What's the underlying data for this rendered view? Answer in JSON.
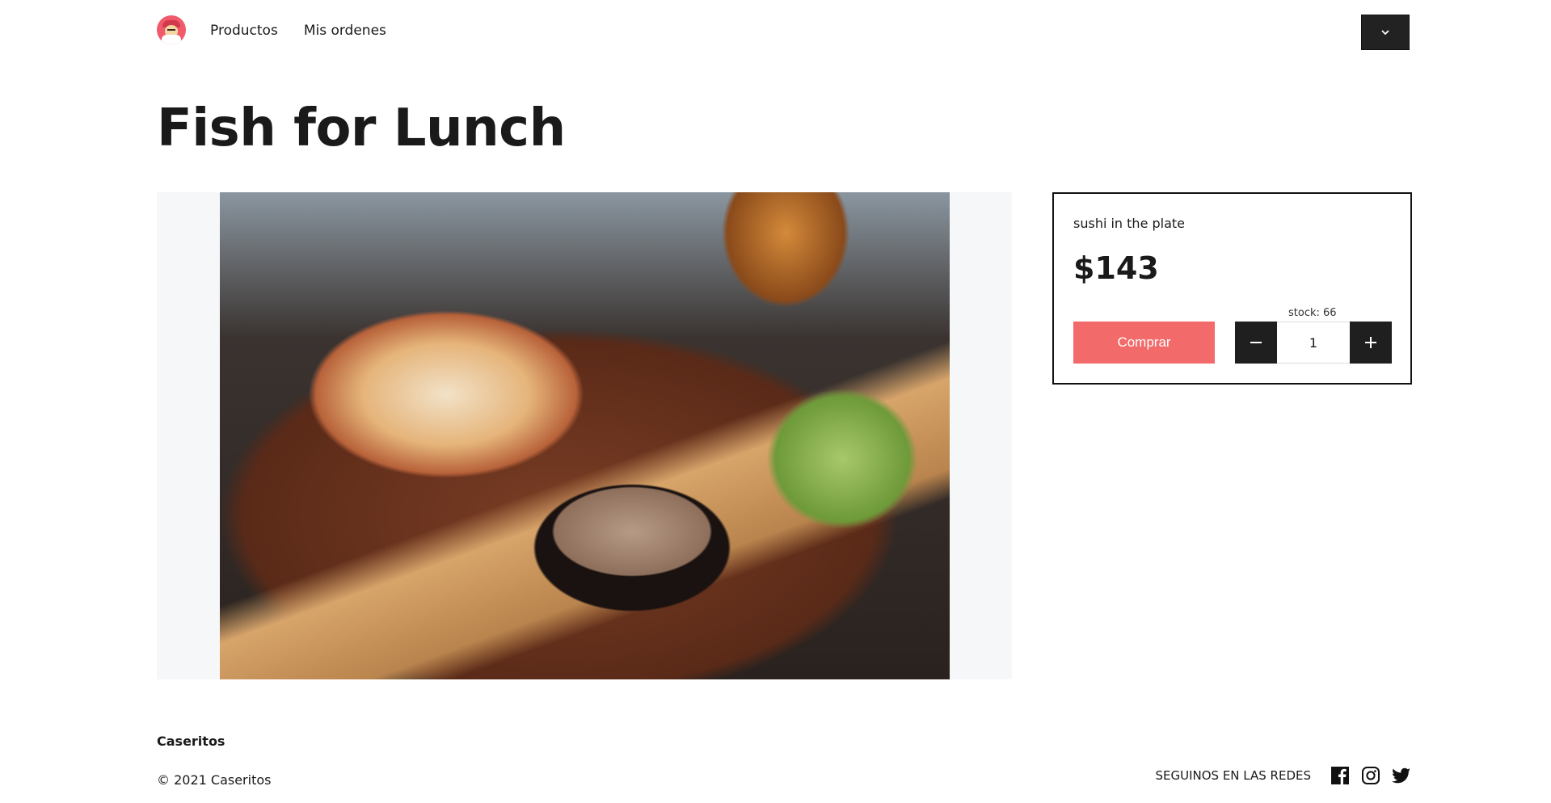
{
  "header": {
    "logo": "caseritos-logo",
    "nav": [
      {
        "label": "Productos"
      },
      {
        "label": "Mis ordenes"
      }
    ],
    "menu_icon": "chevron-down-icon"
  },
  "product": {
    "title": "Fish for Lunch",
    "description": "sushi in the plate",
    "price": "$143",
    "stock": "stock: 66",
    "buy_label": "Comprar",
    "quantity": "1"
  },
  "footer": {
    "brand": "Caseritos",
    "copyright": "© 2021 Caseritos",
    "social_label": "SEGUINOS EN LAS REDES",
    "social_icons": [
      "facebook-icon",
      "instagram-icon",
      "twitter-icon"
    ]
  },
  "colors": {
    "accent": "#f36a6a",
    "dark": "#1f1f1f"
  }
}
